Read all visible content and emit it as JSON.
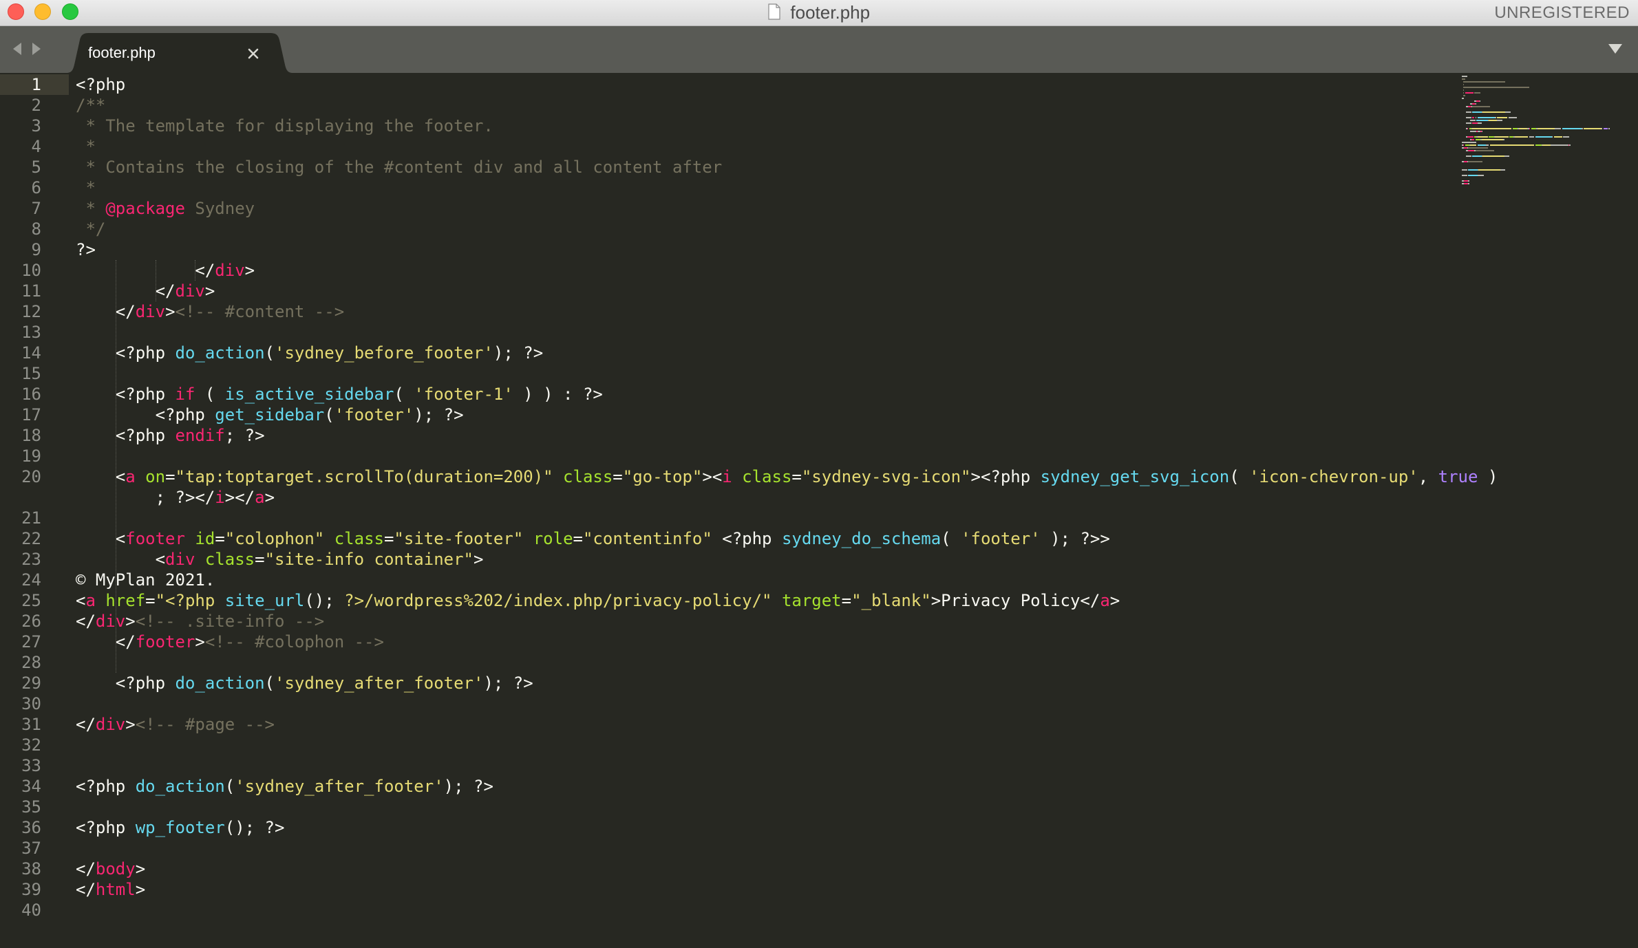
{
  "window": {
    "title": "footer.php",
    "license_status": "UNREGISTERED"
  },
  "tabs": [
    {
      "label": "footer.php",
      "active": true
    }
  ],
  "icons": {
    "traffic_lights": [
      "close-light",
      "minimize-light",
      "maximize-light"
    ],
    "title_icon": "document-icon",
    "nav": [
      "back-arrow-icon",
      "forward-arrow-icon"
    ],
    "tab_close": "close-icon",
    "tab_menu": "dropdown-triangle-icon"
  },
  "theme": {
    "background": "#272822",
    "gutter_text": "#8f908a",
    "comment": "#75715e",
    "keyword": "#f92672",
    "attribute": "#a6e22e",
    "string": "#e6db74",
    "function": "#66d9ef",
    "constant": "#ae81ff",
    "plain": "#f8f8f2"
  },
  "editor": {
    "active_line": 1,
    "lines": [
      {
        "n": "1",
        "tokens": [
          [
            "t-plain",
            "<?php"
          ]
        ]
      },
      {
        "n": "2",
        "tokens": [
          [
            "t-cmt",
            "/**"
          ]
        ]
      },
      {
        "n": "3",
        "tokens": [
          [
            "t-cmt",
            " * The template for displaying the footer."
          ]
        ]
      },
      {
        "n": "4",
        "tokens": [
          [
            "t-cmt",
            " *"
          ]
        ]
      },
      {
        "n": "5",
        "tokens": [
          [
            "t-cmt",
            " * Contains the closing of the #content div and all content after"
          ]
        ]
      },
      {
        "n": "6",
        "tokens": [
          [
            "t-cmt",
            " *"
          ]
        ]
      },
      {
        "n": "7",
        "tokens": [
          [
            "t-cmt",
            " * "
          ],
          [
            "t-kw",
            "@package"
          ],
          [
            "t-cmt",
            " Sydney"
          ]
        ]
      },
      {
        "n": "8",
        "tokens": [
          [
            "t-cmt",
            " */"
          ]
        ]
      },
      {
        "n": "9",
        "tokens": [
          [
            "t-plain",
            "?>"
          ]
        ]
      },
      {
        "n": "10",
        "tokens": [
          [
            "t-plain",
            "            </"
          ],
          [
            "t-tag",
            "div"
          ],
          [
            "t-plain",
            ">"
          ]
        ]
      },
      {
        "n": "11",
        "tokens": [
          [
            "t-plain",
            "        </"
          ],
          [
            "t-tag",
            "div"
          ],
          [
            "t-plain",
            ">"
          ]
        ]
      },
      {
        "n": "12",
        "tokens": [
          [
            "t-plain",
            "    </"
          ],
          [
            "t-tag",
            "div"
          ],
          [
            "t-plain",
            ">"
          ],
          [
            "t-cmt",
            "<!-- #content -->"
          ]
        ]
      },
      {
        "n": "13",
        "tokens": []
      },
      {
        "n": "14",
        "tokens": [
          [
            "t-plain",
            "    <?php "
          ],
          [
            "t-fn",
            "do_action"
          ],
          [
            "t-plain",
            "("
          ],
          [
            "t-str",
            "'sydney_before_footer'"
          ],
          [
            "t-plain",
            "); ?>"
          ]
        ]
      },
      {
        "n": "15",
        "tokens": []
      },
      {
        "n": "16",
        "tokens": [
          [
            "t-plain",
            "    <?php "
          ],
          [
            "t-kw",
            "if"
          ],
          [
            "t-plain",
            " ( "
          ],
          [
            "t-fn",
            "is_active_sidebar"
          ],
          [
            "t-plain",
            "( "
          ],
          [
            "t-str",
            "'footer-1'"
          ],
          [
            "t-plain",
            " ) ) : ?>"
          ]
        ]
      },
      {
        "n": "17",
        "tokens": [
          [
            "t-plain",
            "        <?php "
          ],
          [
            "t-fn",
            "get_sidebar"
          ],
          [
            "t-plain",
            "("
          ],
          [
            "t-str",
            "'footer'"
          ],
          [
            "t-plain",
            "); ?>"
          ]
        ]
      },
      {
        "n": "18",
        "tokens": [
          [
            "t-plain",
            "    <?php "
          ],
          [
            "t-kw",
            "endif"
          ],
          [
            "t-plain",
            "; ?>"
          ]
        ]
      },
      {
        "n": "19",
        "tokens": []
      },
      {
        "n": "20",
        "tokens": [
          [
            "t-plain",
            "    <"
          ],
          [
            "t-tag",
            "a"
          ],
          [
            "t-plain",
            " "
          ],
          [
            "t-attr",
            "on"
          ],
          [
            "t-plain",
            "="
          ],
          [
            "t-str",
            "\"tap:toptarget.scrollTo(duration=200)\""
          ],
          [
            "t-plain",
            " "
          ],
          [
            "t-attr",
            "class"
          ],
          [
            "t-plain",
            "="
          ],
          [
            "t-str",
            "\"go-top\""
          ],
          [
            "t-plain",
            "><"
          ],
          [
            "t-tag",
            "i"
          ],
          [
            "t-plain",
            " "
          ],
          [
            "t-attr",
            "class"
          ],
          [
            "t-plain",
            "="
          ],
          [
            "t-str",
            "\"sydney-svg-icon\""
          ],
          [
            "t-plain",
            "><?php "
          ],
          [
            "t-fn",
            "sydney_get_svg_icon"
          ],
          [
            "t-plain",
            "( "
          ],
          [
            "t-str",
            "'icon-chevron-up'"
          ],
          [
            "t-plain",
            ", "
          ],
          [
            "t-const",
            "true"
          ],
          [
            "t-plain",
            " )"
          ]
        ]
      },
      {
        "n": "",
        "tokens": [
          [
            "t-plain",
            "        ; ?></"
          ],
          [
            "t-tag",
            "i"
          ],
          [
            "t-plain",
            "></"
          ],
          [
            "t-tag",
            "a"
          ],
          [
            "t-plain",
            ">"
          ]
        ]
      },
      {
        "n": "21",
        "tokens": []
      },
      {
        "n": "22",
        "tokens": [
          [
            "t-plain",
            "    <"
          ],
          [
            "t-tag",
            "footer"
          ],
          [
            "t-plain",
            " "
          ],
          [
            "t-attr",
            "id"
          ],
          [
            "t-plain",
            "="
          ],
          [
            "t-str",
            "\"colophon\""
          ],
          [
            "t-plain",
            " "
          ],
          [
            "t-attr",
            "class"
          ],
          [
            "t-plain",
            "="
          ],
          [
            "t-str",
            "\"site-footer\""
          ],
          [
            "t-plain",
            " "
          ],
          [
            "t-attr",
            "role"
          ],
          [
            "t-plain",
            "="
          ],
          [
            "t-str",
            "\"contentinfo\""
          ],
          [
            "t-plain",
            " <?php "
          ],
          [
            "t-fn",
            "sydney_do_schema"
          ],
          [
            "t-plain",
            "( "
          ],
          [
            "t-str",
            "'footer'"
          ],
          [
            "t-plain",
            " ); ?>>"
          ]
        ]
      },
      {
        "n": "23",
        "tokens": [
          [
            "t-plain",
            "        <"
          ],
          [
            "t-tag",
            "div"
          ],
          [
            "t-plain",
            " "
          ],
          [
            "t-attr",
            "class"
          ],
          [
            "t-plain",
            "="
          ],
          [
            "t-str",
            "\"site-info container\""
          ],
          [
            "t-plain",
            ">"
          ]
        ]
      },
      {
        "n": "24",
        "tokens": [
          [
            "t-plain",
            "© MyPlan 2021."
          ]
        ]
      },
      {
        "n": "25",
        "tokens": [
          [
            "t-plain",
            "<"
          ],
          [
            "t-tag",
            "a"
          ],
          [
            "t-plain",
            " "
          ],
          [
            "t-attr",
            "href"
          ],
          [
            "t-plain",
            "="
          ],
          [
            "t-str",
            "\"<?php "
          ],
          [
            "t-fn",
            "site_url"
          ],
          [
            "t-plain",
            "(); "
          ],
          [
            "t-str",
            "?>/wordpress%202/index.php/privacy-policy/\""
          ],
          [
            "t-plain",
            " "
          ],
          [
            "t-attr",
            "target"
          ],
          [
            "t-plain",
            "="
          ],
          [
            "t-str",
            "\"_blank\""
          ],
          [
            "t-plain",
            ">Privacy Policy</"
          ],
          [
            "t-tag",
            "a"
          ],
          [
            "t-plain",
            ">"
          ]
        ]
      },
      {
        "n": "26",
        "tokens": [
          [
            "t-plain",
            "</"
          ],
          [
            "t-tag",
            "div"
          ],
          [
            "t-plain",
            ">"
          ],
          [
            "t-cmt",
            "<!-- .site-info -->"
          ]
        ]
      },
      {
        "n": "27",
        "tokens": [
          [
            "t-plain",
            "    </"
          ],
          [
            "t-tag",
            "footer"
          ],
          [
            "t-plain",
            ">"
          ],
          [
            "t-cmt",
            "<!-- #colophon -->"
          ]
        ]
      },
      {
        "n": "28",
        "tokens": []
      },
      {
        "n": "29",
        "tokens": [
          [
            "t-plain",
            "    <?php "
          ],
          [
            "t-fn",
            "do_action"
          ],
          [
            "t-plain",
            "("
          ],
          [
            "t-str",
            "'sydney_after_footer'"
          ],
          [
            "t-plain",
            "); ?>"
          ]
        ]
      },
      {
        "n": "30",
        "tokens": []
      },
      {
        "n": "31",
        "tokens": [
          [
            "t-plain",
            "</"
          ],
          [
            "t-tag",
            "div"
          ],
          [
            "t-plain",
            ">"
          ],
          [
            "t-cmt",
            "<!-- #page -->"
          ]
        ]
      },
      {
        "n": "32",
        "tokens": []
      },
      {
        "n": "33",
        "tokens": []
      },
      {
        "n": "34",
        "tokens": [
          [
            "t-plain",
            "<?php "
          ],
          [
            "t-fn",
            "do_action"
          ],
          [
            "t-plain",
            "("
          ],
          [
            "t-str",
            "'sydney_after_footer'"
          ],
          [
            "t-plain",
            "); ?>"
          ]
        ]
      },
      {
        "n": "35",
        "tokens": []
      },
      {
        "n": "36",
        "tokens": [
          [
            "t-plain",
            "<?php "
          ],
          [
            "t-fn",
            "wp_footer"
          ],
          [
            "t-plain",
            "(); ?>"
          ]
        ]
      },
      {
        "n": "37",
        "tokens": []
      },
      {
        "n": "38",
        "tokens": [
          [
            "t-plain",
            "</"
          ],
          [
            "t-tag",
            "body"
          ],
          [
            "t-plain",
            ">"
          ]
        ]
      },
      {
        "n": "39",
        "tokens": [
          [
            "t-plain",
            "</"
          ],
          [
            "t-tag",
            "html"
          ],
          [
            "t-plain",
            ">"
          ]
        ]
      },
      {
        "n": "40",
        "tokens": []
      }
    ]
  }
}
